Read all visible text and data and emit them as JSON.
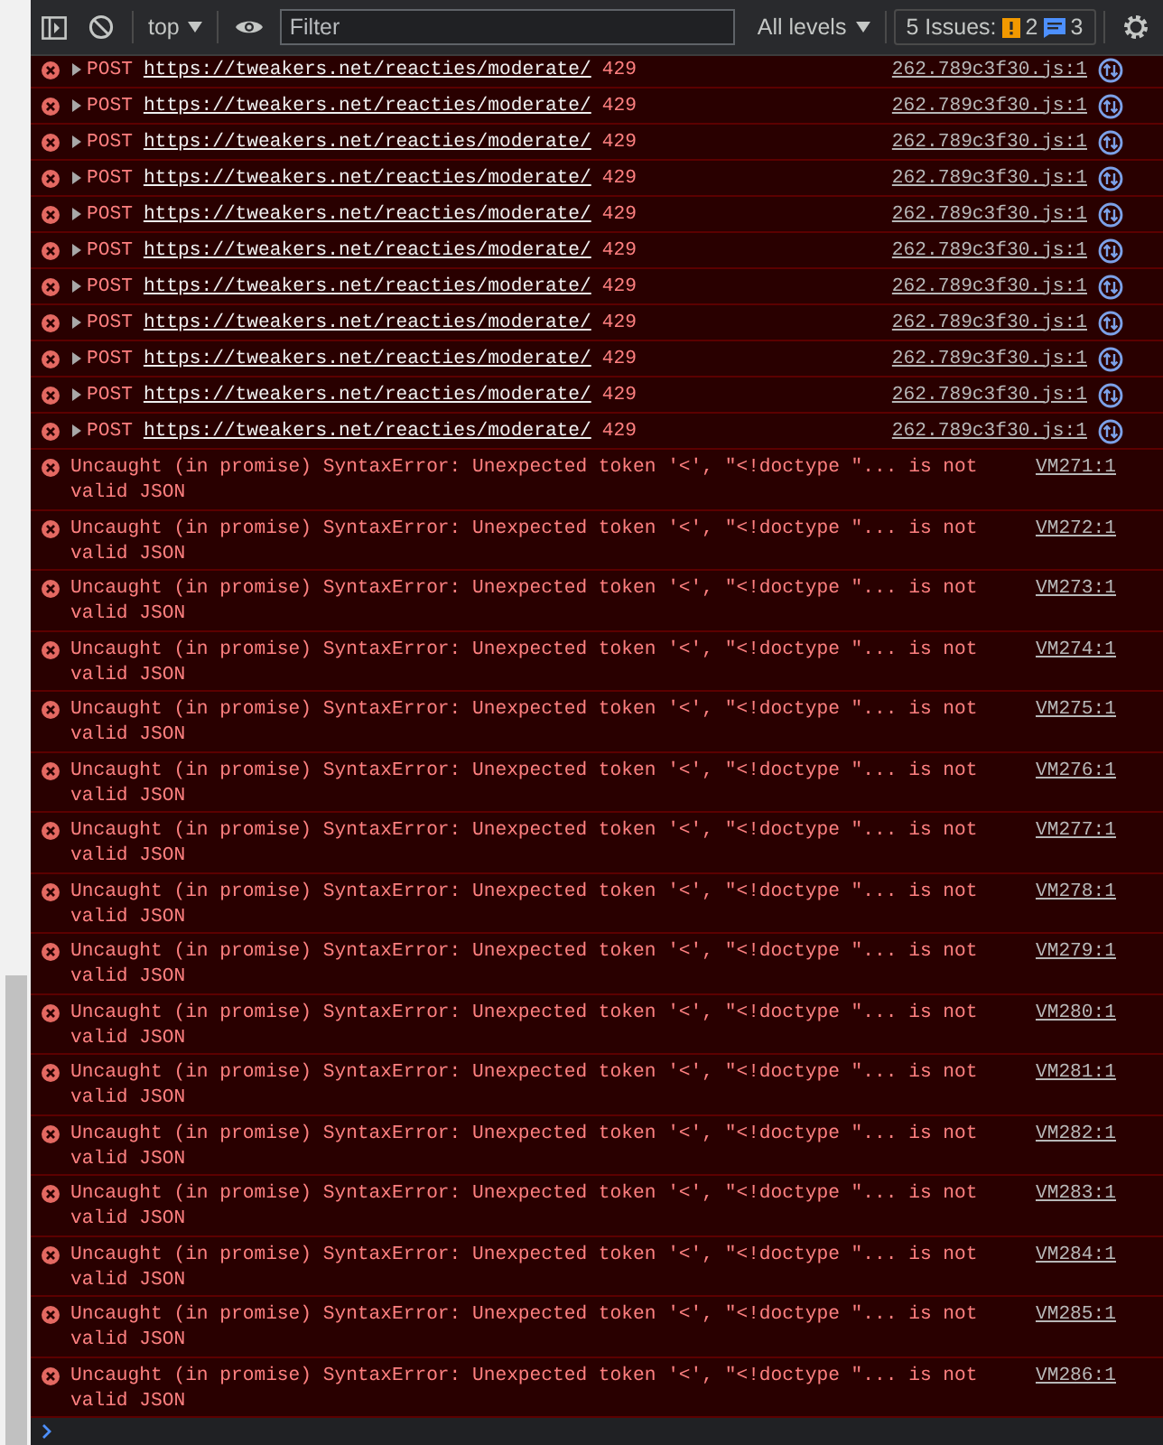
{
  "toolbar": {
    "context": "top",
    "filter": {
      "placeholder": "Filter"
    },
    "levels": "All levels",
    "issues": {
      "label": "5 Issues:",
      "warnings": "2",
      "infos": "3"
    }
  },
  "messages": [
    {
      "kind": "network",
      "method": "POST",
      "url": "https://tweakers.net/reacties/moderate/",
      "status": "429",
      "source": "262.789c3f30.js:1"
    },
    {
      "kind": "network",
      "method": "POST",
      "url": "https://tweakers.net/reacties/moderate/",
      "status": "429",
      "source": "262.789c3f30.js:1"
    },
    {
      "kind": "network",
      "method": "POST",
      "url": "https://tweakers.net/reacties/moderate/",
      "status": "429",
      "source": "262.789c3f30.js:1"
    },
    {
      "kind": "network",
      "method": "POST",
      "url": "https://tweakers.net/reacties/moderate/",
      "status": "429",
      "source": "262.789c3f30.js:1"
    },
    {
      "kind": "network",
      "method": "POST",
      "url": "https://tweakers.net/reacties/moderate/",
      "status": "429",
      "source": "262.789c3f30.js:1"
    },
    {
      "kind": "network",
      "method": "POST",
      "url": "https://tweakers.net/reacties/moderate/",
      "status": "429",
      "source": "262.789c3f30.js:1"
    },
    {
      "kind": "network",
      "method": "POST",
      "url": "https://tweakers.net/reacties/moderate/",
      "status": "429",
      "source": "262.789c3f30.js:1"
    },
    {
      "kind": "network",
      "method": "POST",
      "url": "https://tweakers.net/reacties/moderate/",
      "status": "429",
      "source": "262.789c3f30.js:1"
    },
    {
      "kind": "network",
      "method": "POST",
      "url": "https://tweakers.net/reacties/moderate/",
      "status": "429",
      "source": "262.789c3f30.js:1"
    },
    {
      "kind": "network",
      "method": "POST",
      "url": "https://tweakers.net/reacties/moderate/",
      "status": "429",
      "source": "262.789c3f30.js:1"
    },
    {
      "kind": "network",
      "method": "POST",
      "url": "https://tweakers.net/reacties/moderate/",
      "status": "429",
      "source": "262.789c3f30.js:1"
    },
    {
      "kind": "exception",
      "text": "Uncaught (in promise) SyntaxError: Unexpected token '<', \"<!doctype \"... is not valid JSON",
      "source": "VM271:1"
    },
    {
      "kind": "exception",
      "text": "Uncaught (in promise) SyntaxError: Unexpected token '<', \"<!doctype \"... is not valid JSON",
      "source": "VM272:1"
    },
    {
      "kind": "exception",
      "text": "Uncaught (in promise) SyntaxError: Unexpected token '<', \"<!doctype \"... is not valid JSON",
      "source": "VM273:1"
    },
    {
      "kind": "exception",
      "text": "Uncaught (in promise) SyntaxError: Unexpected token '<', \"<!doctype \"... is not valid JSON",
      "source": "VM274:1"
    },
    {
      "kind": "exception",
      "text": "Uncaught (in promise) SyntaxError: Unexpected token '<', \"<!doctype \"... is not valid JSON",
      "source": "VM275:1"
    },
    {
      "kind": "exception",
      "text": "Uncaught (in promise) SyntaxError: Unexpected token '<', \"<!doctype \"... is not valid JSON",
      "source": "VM276:1"
    },
    {
      "kind": "exception",
      "text": "Uncaught (in promise) SyntaxError: Unexpected token '<', \"<!doctype \"... is not valid JSON",
      "source": "VM277:1"
    },
    {
      "kind": "exception",
      "text": "Uncaught (in promise) SyntaxError: Unexpected token '<', \"<!doctype \"... is not valid JSON",
      "source": "VM278:1"
    },
    {
      "kind": "exception",
      "text": "Uncaught (in promise) SyntaxError: Unexpected token '<', \"<!doctype \"... is not valid JSON",
      "source": "VM279:1"
    },
    {
      "kind": "exception",
      "text": "Uncaught (in promise) SyntaxError: Unexpected token '<', \"<!doctype \"... is not valid JSON",
      "source": "VM280:1"
    },
    {
      "kind": "exception",
      "text": "Uncaught (in promise) SyntaxError: Unexpected token '<', \"<!doctype \"... is not valid JSON",
      "source": "VM281:1"
    },
    {
      "kind": "exception",
      "text": "Uncaught (in promise) SyntaxError: Unexpected token '<', \"<!doctype \"... is not valid JSON",
      "source": "VM282:1"
    },
    {
      "kind": "exception",
      "text": "Uncaught (in promise) SyntaxError: Unexpected token '<', \"<!doctype \"... is not valid JSON",
      "source": "VM283:1"
    },
    {
      "kind": "exception",
      "text": "Uncaught (in promise) SyntaxError: Unexpected token '<', \"<!doctype \"... is not valid JSON",
      "source": "VM284:1"
    },
    {
      "kind": "exception",
      "text": "Uncaught (in promise) SyntaxError: Unexpected token '<', \"<!doctype \"... is not valid JSON",
      "source": "VM285:1"
    },
    {
      "kind": "exception",
      "text": "Uncaught (in promise) SyntaxError: Unexpected token '<', \"<!doctype \"... is not valid JSON",
      "source": "VM286:1"
    }
  ]
}
